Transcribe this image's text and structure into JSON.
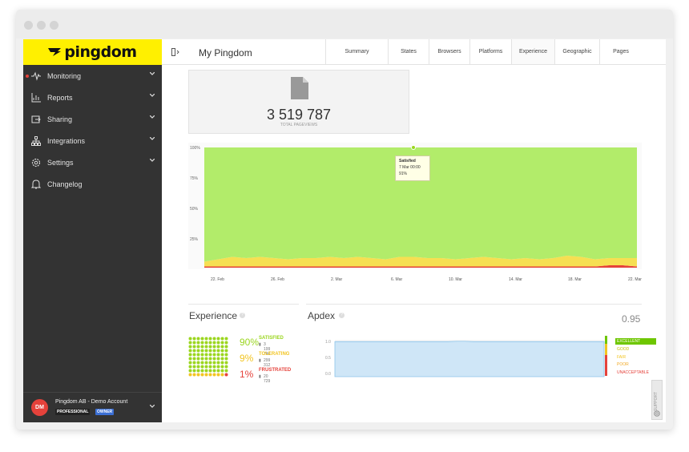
{
  "app": {
    "brand": "pingdom",
    "page_title": "My Pingdom"
  },
  "sidebar": {
    "items": [
      {
        "label": "Monitoring",
        "icon": "pulse-icon"
      },
      {
        "label": "Reports",
        "icon": "bar-chart-icon"
      },
      {
        "label": "Sharing",
        "icon": "share-icon"
      },
      {
        "label": "Integrations",
        "icon": "network-icon"
      },
      {
        "label": "Settings",
        "icon": "gear-icon"
      },
      {
        "label": "Changelog",
        "icon": "bell-icon"
      }
    ],
    "account": {
      "initials": "DM",
      "name": "Pingdom AB - Demo Account",
      "plan": "PROFESSIONAL",
      "role": "OWNER"
    }
  },
  "tabs": [
    "Summary",
    "States",
    "Browsers",
    "Platforms",
    "Experience",
    "Geographic",
    "Pages"
  ],
  "active_tab": "Experience",
  "pageviews": {
    "value": "3 519 787",
    "label": "TOTAL PAGEVIEWS"
  },
  "tooltip": {
    "title": "Satisfied",
    "date": "7 Mar 00:00",
    "value": "91%"
  },
  "experience": {
    "title": "Experience",
    "rows": [
      {
        "pct": "90%",
        "name": "SATISFIED",
        "count": "3 199 746",
        "color": "#9bd61f"
      },
      {
        "pct": "9%",
        "name": "TOLERATING",
        "count": "299 312",
        "color": "#f2c522"
      },
      {
        "pct": "1%",
        "name": "FRUSTRATED",
        "count": "20 729",
        "color": "#e5423b"
      }
    ]
  },
  "apdex": {
    "title": "Apdex",
    "score": "0.95",
    "y_ticks": [
      "1.0",
      "0.5",
      "0.0"
    ],
    "ratings": [
      {
        "label": "EXCELLENT",
        "color": "#6ec600",
        "active": true
      },
      {
        "label": "GOOD",
        "color": "#c8c000",
        "active": false
      },
      {
        "label": "FAIR",
        "color": "#f2c522",
        "active": false
      },
      {
        "label": "POOR",
        "color": "#f2a822",
        "active": false
      },
      {
        "label": "UNACCEPTABLE",
        "color": "#e5423b",
        "active": false
      }
    ]
  },
  "support_label": "SUPPORT",
  "chart_data": {
    "type": "area",
    "x": [
      "20 Feb",
      "21 Feb",
      "22 Feb",
      "23 Feb",
      "24 Feb",
      "25 Feb",
      "26 Feb",
      "27 Feb",
      "28 Feb",
      "1 Mar",
      "2 Mar",
      "3 Mar",
      "4 Mar",
      "5 Mar",
      "6 Mar",
      "7 Mar",
      "8 Mar",
      "9 Mar",
      "10 Mar",
      "11 Mar",
      "12 Mar",
      "13 Mar",
      "14 Mar",
      "15 Mar",
      "16 Mar",
      "17 Mar",
      "18 Mar",
      "19 Mar",
      "20 Mar",
      "21 Mar",
      "22 Mar",
      "23 Mar"
    ],
    "x_ticks": [
      "22. Feb",
      "26. Feb",
      "2. Mar",
      "6. Mar",
      "10. Mar",
      "14. Mar",
      "18. Mar",
      "22. Mar"
    ],
    "y_ticks": [
      "100%",
      "75%",
      "50%",
      "25%"
    ],
    "ylim": [
      0,
      100
    ],
    "stacked": true,
    "series": [
      {
        "name": "Frustrated",
        "color": "#e5423b",
        "values": [
          1,
          1,
          1,
          1,
          1,
          1,
          1,
          1,
          1,
          1,
          1,
          1,
          1,
          1,
          1,
          1,
          1,
          1,
          1,
          1,
          1,
          1,
          1,
          1,
          1,
          1,
          1,
          1,
          1,
          2,
          2,
          1
        ]
      },
      {
        "name": "Tolerating",
        "color": "#f6df52",
        "values": [
          4,
          6,
          8,
          7,
          8,
          7,
          6,
          7,
          7,
          8,
          7,
          8,
          7,
          6,
          8,
          8,
          7,
          7,
          6,
          7,
          8,
          7,
          6,
          7,
          6,
          7,
          9,
          8,
          6,
          6,
          6,
          7
        ]
      },
      {
        "name": "Satisfied",
        "color": "#b2ec6a",
        "values": [
          95,
          93,
          91,
          92,
          91,
          92,
          93,
          92,
          92,
          91,
          92,
          91,
          92,
          93,
          91,
          91,
          92,
          92,
          93,
          92,
          91,
          92,
          93,
          92,
          93,
          92,
          90,
          91,
          93,
          92,
          92,
          92
        ]
      }
    ],
    "apdex_values": [
      0.95,
      0.95,
      0.95,
      0.95,
      0.95,
      0.95,
      0.95,
      0.95,
      0.95,
      0.95,
      0.95,
      0.95,
      0.95,
      0.95,
      0.96,
      0.96,
      0.95,
      0.95,
      0.95,
      0.95,
      0.95,
      0.95,
      0.95,
      0.95,
      0.95,
      0.95,
      0.95,
      0.95,
      0.95,
      0.95,
      0.95,
      0.95
    ]
  }
}
